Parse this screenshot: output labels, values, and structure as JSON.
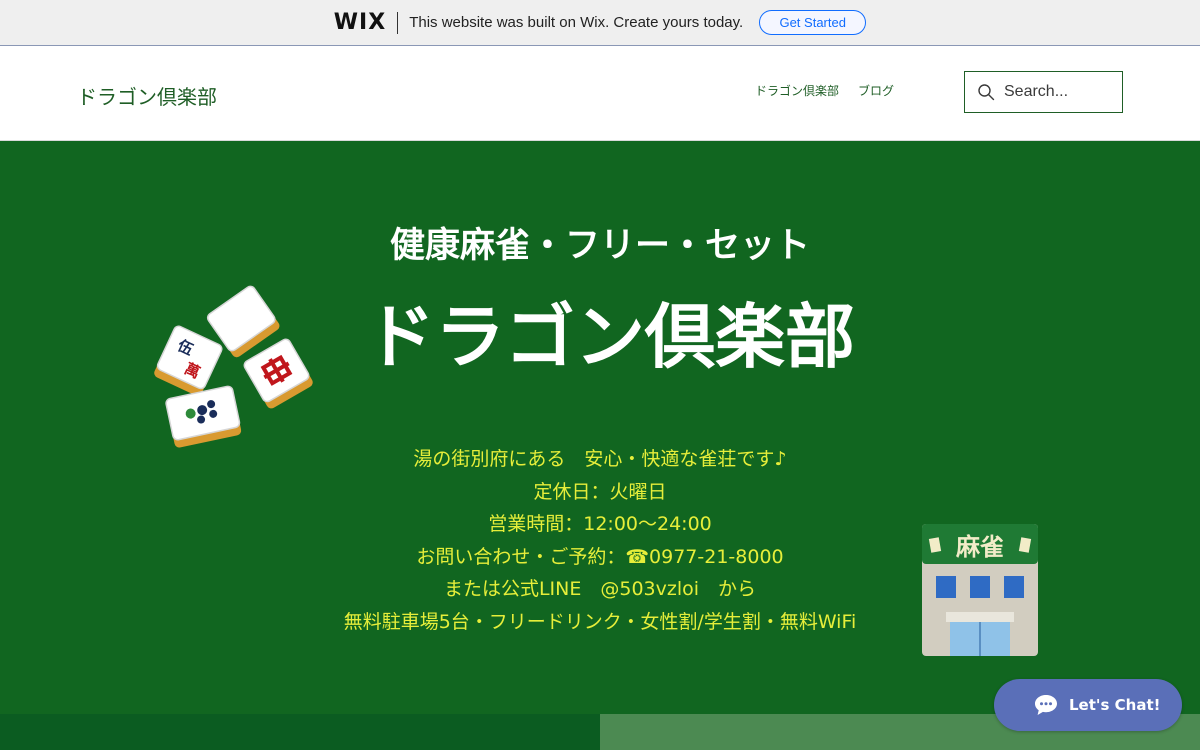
{
  "wix_banner": {
    "logo": "WIX",
    "message": "This website was built on Wix. Create yours today.",
    "cta_label": "Get Started"
  },
  "header": {
    "site_title": "ドラゴン倶楽部",
    "nav": [
      {
        "label": "ドラゴン倶楽部"
      },
      {
        "label": "ブログ"
      }
    ],
    "search_placeholder": "Search..."
  },
  "hero": {
    "subtitle": "健康麻雀・フリー・セット",
    "title": "ドラゴン倶楽部",
    "info_lines": [
      "湯の街別府にある　安心・快適な雀荘です♪",
      "定休日：火曜日",
      "営業時間：12:00〜24:00",
      "お問い合わせ・ご予約：☎0977-21-8000",
      "または公式LINE　@503vzloi　から",
      "無料駐車場5台・フリードリンク・女性割/学生割・無料WiFi"
    ],
    "tiles_labels": {
      "wan": "伍",
      "man": "萬"
    },
    "shop_sign": "麻雀"
  },
  "chat": {
    "label": "Let's Chat!"
  },
  "colors": {
    "hero_bg": "#116620",
    "info_text": "#e6ee3a",
    "brand_green": "#1f5e26",
    "wix_blue": "#116dff",
    "chat_bg": "#5a6fb8"
  }
}
